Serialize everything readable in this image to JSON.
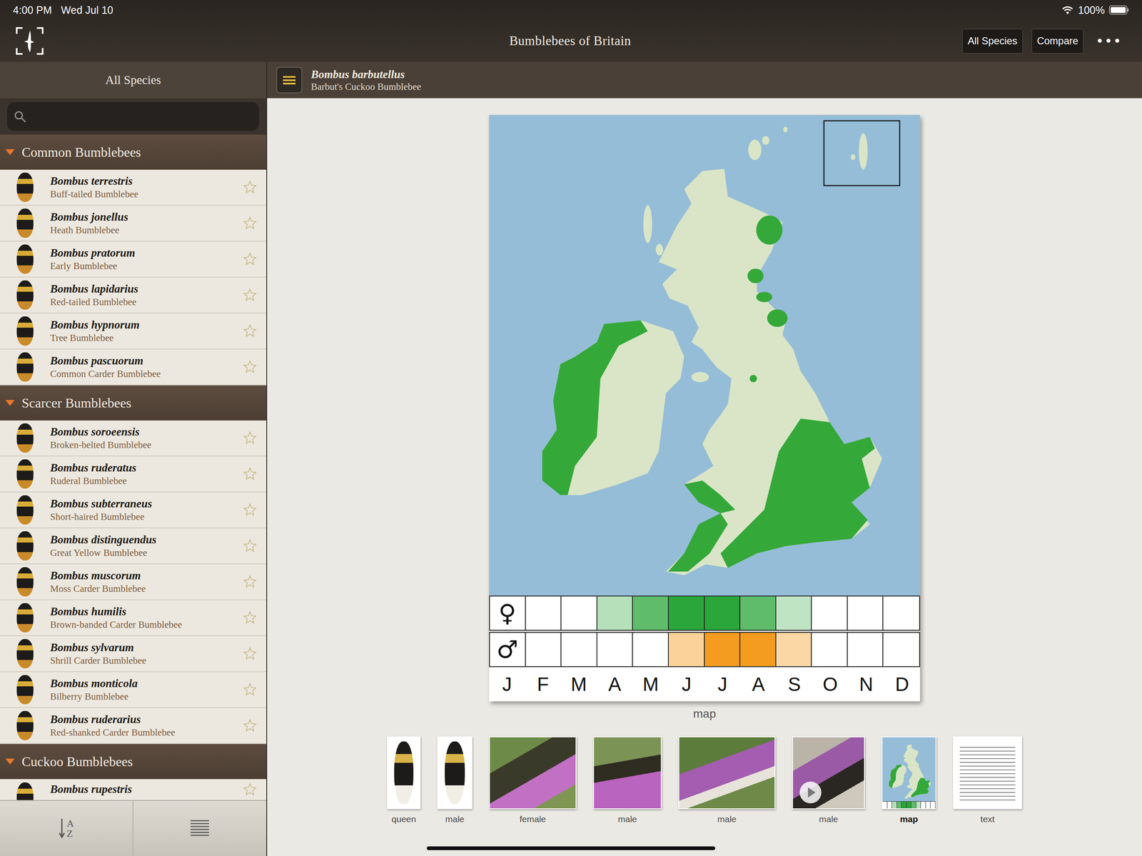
{
  "status_bar": {
    "time": "4:00 PM",
    "date": "Wed Jul 10",
    "battery": "100%",
    "battery_level": 1
  },
  "nav": {
    "title": "Bumblebees of Britain",
    "buttons": [
      {
        "label": "All Species"
      },
      {
        "label": "Compare"
      }
    ],
    "more": "•••"
  },
  "sidebar": {
    "title": "All Species",
    "search": {
      "placeholder": ""
    },
    "sections": [
      {
        "title": "Common Bumblebees",
        "expanded": true,
        "items": [
          {
            "name": "Bombus terrestris",
            "common": "Buff-tailed Bumblebee",
            "starred": false
          },
          {
            "name": "Bombus jonellus",
            "common": "Heath Bumblebee",
            "starred": false
          },
          {
            "name": "Bombus pratorum",
            "common": "Early Bumblebee",
            "starred": false
          },
          {
            "name": "Bombus lapidarius",
            "common": "Red-tailed Bumblebee",
            "starred": false
          },
          {
            "name": "Bombus hypnorum",
            "common": "Tree Bumblebee",
            "starred": false
          },
          {
            "name": "Bombus pascuorum",
            "common": "Common Carder Bumblebee",
            "starred": false
          }
        ]
      },
      {
        "title": "Scarcer Bumblebees",
        "expanded": true,
        "items": [
          {
            "name": "Bombus soroeensis",
            "common": "Broken-belted Bumblebee",
            "starred": false
          },
          {
            "name": "Bombus ruderatus",
            "common": "Ruderal Bumblebee",
            "starred": false
          },
          {
            "name": "Bombus subterraneus",
            "common": "Short-haired Bumblebee",
            "starred": false
          },
          {
            "name": "Bombus distinguendus",
            "common": "Great Yellow Bumblebee",
            "starred": false
          },
          {
            "name": "Bombus muscorum",
            "common": "Moss Carder Bumblebee",
            "starred": false
          },
          {
            "name": "Bombus humilis",
            "common": "Brown-banded Carder Bumblebee",
            "starred": false
          },
          {
            "name": "Bombus sylvarum",
            "common": "Shrill Carder Bumblebee",
            "starred": false
          },
          {
            "name": "Bombus monticola",
            "common": "Bilberry Bumblebee",
            "starred": false
          },
          {
            "name": "Bombus ruderarius",
            "common": "Red-shanked Carder Bumblebee",
            "starred": false
          }
        ]
      },
      {
        "title": "Cuckoo Bumblebees",
        "expanded": true,
        "items": [
          {
            "name": "Bombus rupestris",
            "starred": false
          }
        ]
      }
    ],
    "toolbar": {
      "sort_top": "A",
      "sort_bottom": "Z"
    }
  },
  "species": {
    "scientific": "Bombus barbutellus",
    "common": "Barbut's Cuckoo Bumblebee"
  },
  "phenology": {
    "months": [
      "J",
      "F",
      "M",
      "A",
      "M",
      "J",
      "J",
      "A",
      "S",
      "O",
      "N",
      "D"
    ],
    "female": {
      "symbol": "♀",
      "levels": [
        0,
        0,
        0.35,
        0.75,
        1,
        1,
        0.75,
        0.3,
        0,
        0,
        0
      ]
    },
    "male": {
      "symbol": "♂",
      "levels": [
        0,
        0,
        0,
        0,
        0.45,
        1,
        1,
        0.4,
        0,
        0,
        0
      ]
    }
  },
  "caption": "map",
  "thumbnails": [
    {
      "label": "queen",
      "kind": "specimen",
      "selected": false
    },
    {
      "label": "male",
      "kind": "specimen",
      "selected": false
    },
    {
      "label": "female",
      "kind": "photo",
      "selected": false
    },
    {
      "label": "male",
      "kind": "photo",
      "selected": false
    },
    {
      "label": "male",
      "kind": "photo",
      "selected": false
    },
    {
      "label": "male",
      "kind": "video",
      "selected": false
    },
    {
      "label": "map",
      "kind": "map",
      "selected": true
    },
    {
      "label": "text",
      "kind": "text",
      "selected": false
    }
  ]
}
